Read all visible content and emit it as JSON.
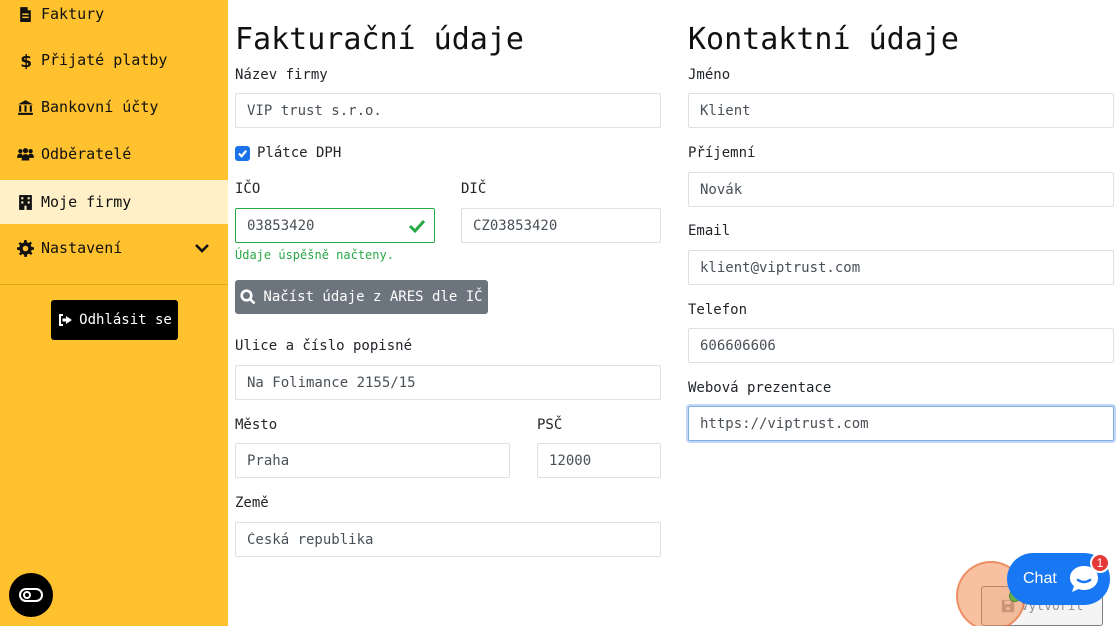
{
  "sidebar": {
    "items": [
      {
        "label": "Faktury",
        "icon": "document-icon"
      },
      {
        "label": "Přijaté platby",
        "icon": "dollar-icon"
      },
      {
        "label": "Bankovní účty",
        "icon": "bank-icon"
      },
      {
        "label": "Odběratelé",
        "icon": "users-icon"
      },
      {
        "label": "Moje firmy",
        "icon": "building-icon"
      },
      {
        "label": "Nastavení",
        "icon": "gear-icon"
      }
    ],
    "logout_label": "Odhlásit se"
  },
  "billing": {
    "title": "Fakturační údaje",
    "company_name_label": "Název firmy",
    "company_name_value": "VIP trust s.r.o.",
    "vat_payer_label": "Plátce DPH",
    "vat_payer_checked": true,
    "ico_label": "IČO",
    "ico_value": "03853420",
    "dic_label": "DIČ",
    "dic_value": "CZ03853420",
    "ico_feedback": "Údaje úspěšně načteny.",
    "ares_button_label": "Načíst údaje z ARES dle IČ",
    "street_label": "Ulice a číslo popisné",
    "street_value": "Na Folimance 2155/15",
    "city_label": "Město",
    "city_value": "Praha",
    "zip_label": "PSČ",
    "zip_value": "12000",
    "country_label": "Země",
    "country_value": "Česká republika"
  },
  "contact": {
    "title": "Kontaktní údaje",
    "first_name_label": "Jméno",
    "first_name_value": "Klient",
    "last_name_label": "Příjemní",
    "last_name_value": "Novák",
    "email_label": "Email",
    "email_value": "klient@viptrust.com",
    "phone_label": "Telefon",
    "phone_value": "606606606",
    "website_label": "Webová prezentace",
    "website_value": "https://viptrust.com"
  },
  "actions": {
    "create_label": "Vytvořit"
  },
  "chat": {
    "label": "Chat",
    "badge_count": "1"
  },
  "colors": {
    "sidebar": "#ffc12e",
    "sidebar_active": "#fff0c8",
    "valid": "#28a745",
    "checkbox": "#1a73e8",
    "ares_button": "#6c757d",
    "chat": "#1877f2"
  }
}
